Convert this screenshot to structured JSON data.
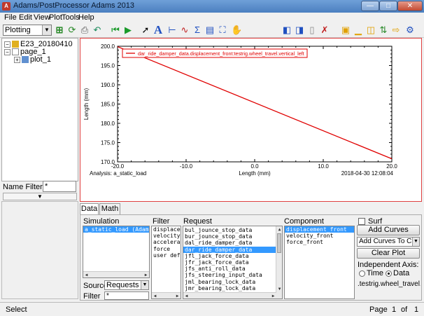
{
  "window": {
    "title": "Adams/PostProcessor Adams 2013",
    "app_icon": "A",
    "minimize": "—",
    "maximize": "□",
    "close": "✕"
  },
  "menu": [
    "File",
    "Edit",
    "View",
    "Plot",
    "Tools",
    "Help"
  ],
  "toolbar": {
    "mode": "Plotting"
  },
  "tree": {
    "root": "E23_20180410",
    "page": "page_1",
    "plot": "plot_1"
  },
  "name_filter": {
    "label": "Name Filter",
    "value": "*"
  },
  "chart_data": {
    "type": "line",
    "series": [
      {
        "name": "dar_ride_damper_data.displacement_front:testrig.wheel_travel.vertical_left",
        "x": [
          -20.0,
          20.0
        ],
        "y": [
          199.9,
          170.8
        ]
      }
    ],
    "xlabel": "Length (mm)",
    "ylabel": "Length (mm)",
    "xlim": [
      -20.0,
      20.0
    ],
    "ylim": [
      170.0,
      200.0
    ],
    "xticks": [
      "-20.0",
      "-10.0",
      "0.0",
      "10.0",
      "20.0"
    ],
    "yticks": [
      "170.0",
      "175.0",
      "180.0",
      "185.0",
      "190.0",
      "195.0",
      "200.0"
    ],
    "analysis": "Analysis:  a_static_load",
    "timestamp": "2018-04-30 12:08:04",
    "line_color": "#e00000",
    "grid": false,
    "legend_position": "top-left"
  },
  "tabs": [
    "Data",
    "Math"
  ],
  "simulation": {
    "header": "Simulation",
    "items": [
      "a_static_load    (Adams"
    ],
    "source_label": "Source",
    "source_value": "Requests",
    "filter_label": "Filter",
    "filter_value": "*"
  },
  "filter": {
    "header": "Filter",
    "items": [
      "displaceme",
      "velocity",
      "accelerati",
      "force",
      "user defir"
    ]
  },
  "request": {
    "header": "Request",
    "items": [
      "bul_jounce_stop_data",
      "bur_jounce_stop_data",
      "dal_ride_damper_data",
      "dar_ride_damper_data",
      "jfl_jack_force_data",
      "jfr_jack_force_data",
      "jfs_anti_roll_data",
      "jfs_steering_input_data",
      "jml_bearing_lock_data",
      "jmr_bearing_lock_data"
    ],
    "selected_index": 3
  },
  "component": {
    "header": "Component",
    "items": [
      "displacement_front",
      "velocity_front",
      "force_front"
    ],
    "selected_index": 0
  },
  "controls": {
    "surf_label": "Surf",
    "add_curves": "Add Curves",
    "add_mode": "Add Curves To Current",
    "clear_plot": "Clear Plot",
    "independent_axis_label": "Independent Axis:",
    "time_label": "Time",
    "data_label": "Data",
    "independent_value": ".testrig.wheel_travel.vertica"
  },
  "status": {
    "text": "Select",
    "page_label": "Page",
    "page_current": "1",
    "page_of": "of",
    "page_total": "1"
  }
}
